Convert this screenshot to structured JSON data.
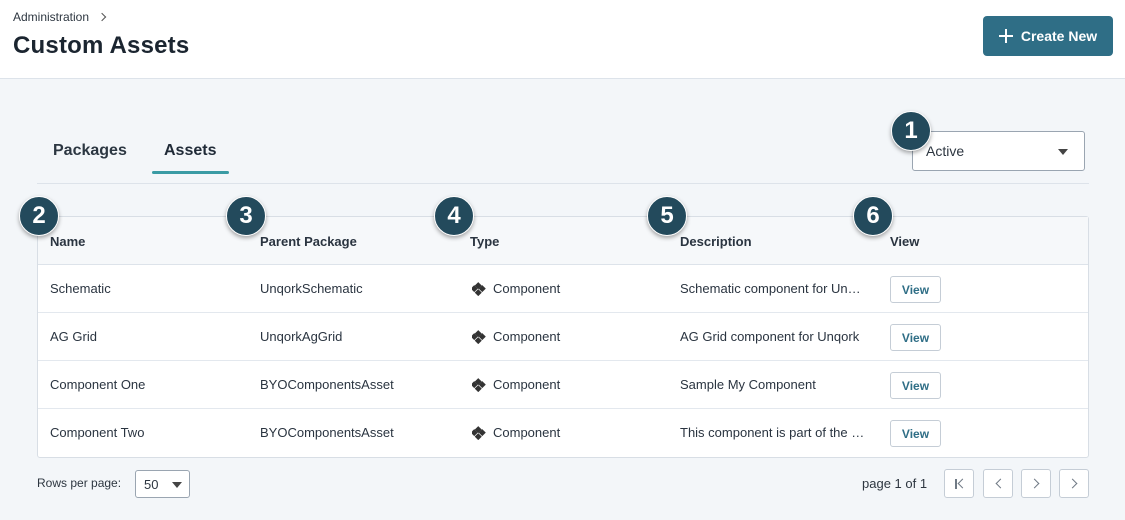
{
  "header": {
    "breadcrumb": "Administration",
    "title": "Custom Assets",
    "create_button": "Create New"
  },
  "tabs": [
    {
      "label": "Packages",
      "active": false
    },
    {
      "label": "Assets",
      "active": true
    }
  ],
  "status_filter": {
    "selected": "Active"
  },
  "table": {
    "columns": [
      "Name",
      "Parent Package",
      "Type",
      "Description",
      "View"
    ],
    "rows": [
      {
        "name": "Schematic",
        "parent_package": "UnqorkSchematic",
        "type": "Component",
        "description": "Schematic component for Unqork",
        "view": "View"
      },
      {
        "name": "AG Grid",
        "parent_package": "UnqorkAgGrid",
        "type": "Component",
        "description": "AG Grid component for Unqork",
        "view": "View"
      },
      {
        "name": "Component One",
        "parent_package": "BYOComponentsAsset",
        "type": "Component",
        "description": "Sample My Component",
        "view": "View"
      },
      {
        "name": "Component Two",
        "parent_package": "BYOComponentsAsset",
        "type": "Component",
        "description": "This component is part of the package",
        "view": "View"
      }
    ],
    "type_icon": "component-diamonds-icon"
  },
  "callouts": [
    "1",
    "2",
    "3",
    "4",
    "5",
    "6"
  ],
  "pagination": {
    "rows_per_page_label": "Rows per page:",
    "rows_per_page": "50",
    "page_info": "page 1 of 1"
  },
  "colors": {
    "primary": "#2f6e86",
    "badge": "#234a5c",
    "tab_underline": "#3a9ba4"
  }
}
